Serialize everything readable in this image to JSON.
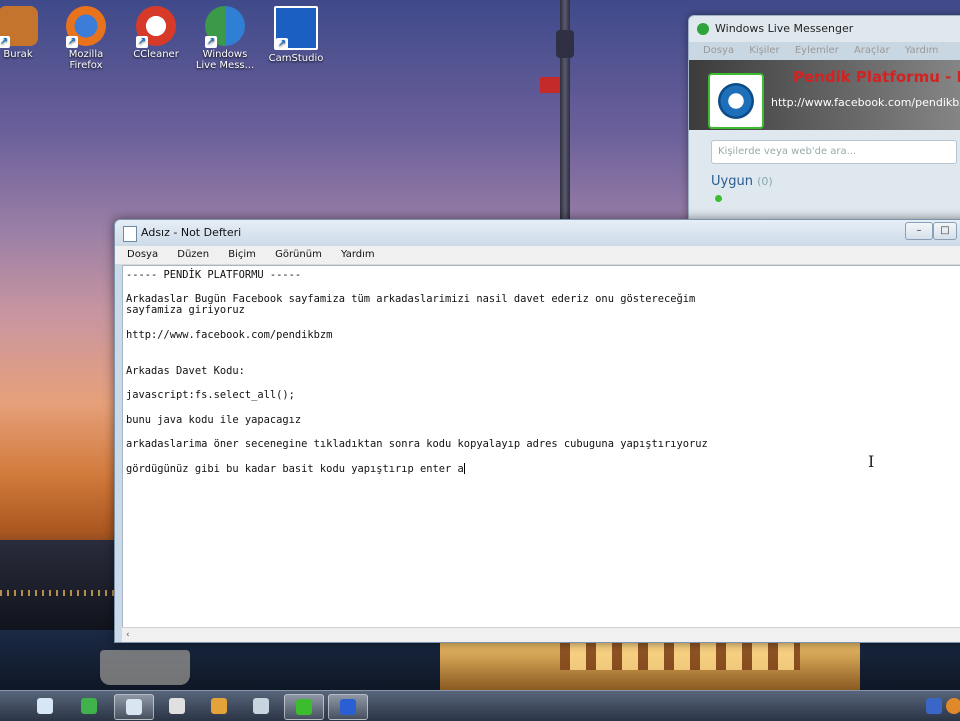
{
  "desktop": {
    "icons": [
      {
        "label": "Burak",
        "color": "#c4742c"
      },
      {
        "label": "Mozilla Firefox",
        "color": "#e8731c"
      },
      {
        "label": "CCleaner",
        "color": "#d83a2a"
      },
      {
        "label": "Windows Live Mess...",
        "color": "#3a9a4a"
      },
      {
        "label": "CamStudio",
        "color": "#1b5fc2"
      }
    ]
  },
  "messenger": {
    "title": "Windows Live Messenger",
    "menu": [
      "Dosya",
      "Kişiler",
      "Eylemler",
      "Araçlar",
      "Yardım"
    ],
    "display_name": "Pendik Platformu - E",
    "personal_message": "http://www.facebook.com/pendikbzm",
    "search_placeholder": "Kişilerde veya web'de ara...",
    "group": "Uygun",
    "group_count": "(0)"
  },
  "notepad": {
    "title": "Adsız - Not Defteri",
    "menu": [
      "Dosya",
      "Düzen",
      "Biçim",
      "Görünüm",
      "Yardım"
    ],
    "controls": {
      "minimize": "–",
      "maximize": "□",
      "close": "✕"
    },
    "lines": [
      "----- PENDİK PLATFORMU -----",
      "",
      "Arkadaslar Bugün Facebook sayfamiza tüm arkadaslarimizi nasil davet ederiz onu göstereceğim",
      "sayfamiza giriyoruz",
      "",
      "http://www.facebook.com/pendikbzm",
      "",
      "",
      "Arkadas Davet Kodu:",
      "",
      "javascript:fs.select_all();",
      "",
      "bunu java kodu ile yapacagız",
      "",
      "arkadaslarima öner secenegine tıkladıktan sonra kodu kopyalayıp adres cubuguna yapıştırıyoruz",
      "",
      "gördügünüz gibi bu kadar basit kodu yapıştırıp enter a"
    ]
  },
  "taskbar": {
    "items": [
      {
        "name": "start",
        "color": "#e9e9e9"
      },
      {
        "name": "explorer",
        "color": "#d7e6f5"
      },
      {
        "name": "media",
        "color": "#3fb34a"
      },
      {
        "name": "notepad",
        "color": "#d9e6f2"
      },
      {
        "name": "app1",
        "color": "#e0e0e0"
      },
      {
        "name": "app2",
        "color": "#e4a23a"
      },
      {
        "name": "app3",
        "color": "#c8d4de"
      },
      {
        "name": "messenger",
        "color": "#3cbc2f"
      },
      {
        "name": "camstudio",
        "color": "#2a5fd4"
      }
    ]
  }
}
